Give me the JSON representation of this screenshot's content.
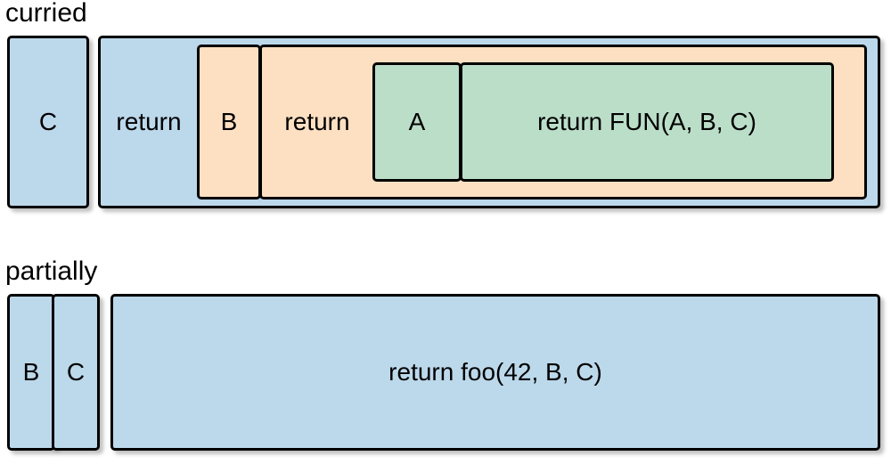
{
  "curried": {
    "label": "curried",
    "outer_param": "C",
    "outer_body_kw": "return",
    "mid_param": "B",
    "mid_body_kw": "return",
    "inner_param": "A",
    "inner_body": "return FUN(A, B, C)"
  },
  "partially": {
    "label": "partially",
    "params": [
      "B",
      "C"
    ],
    "body": "return foo(42, B, C)"
  }
}
